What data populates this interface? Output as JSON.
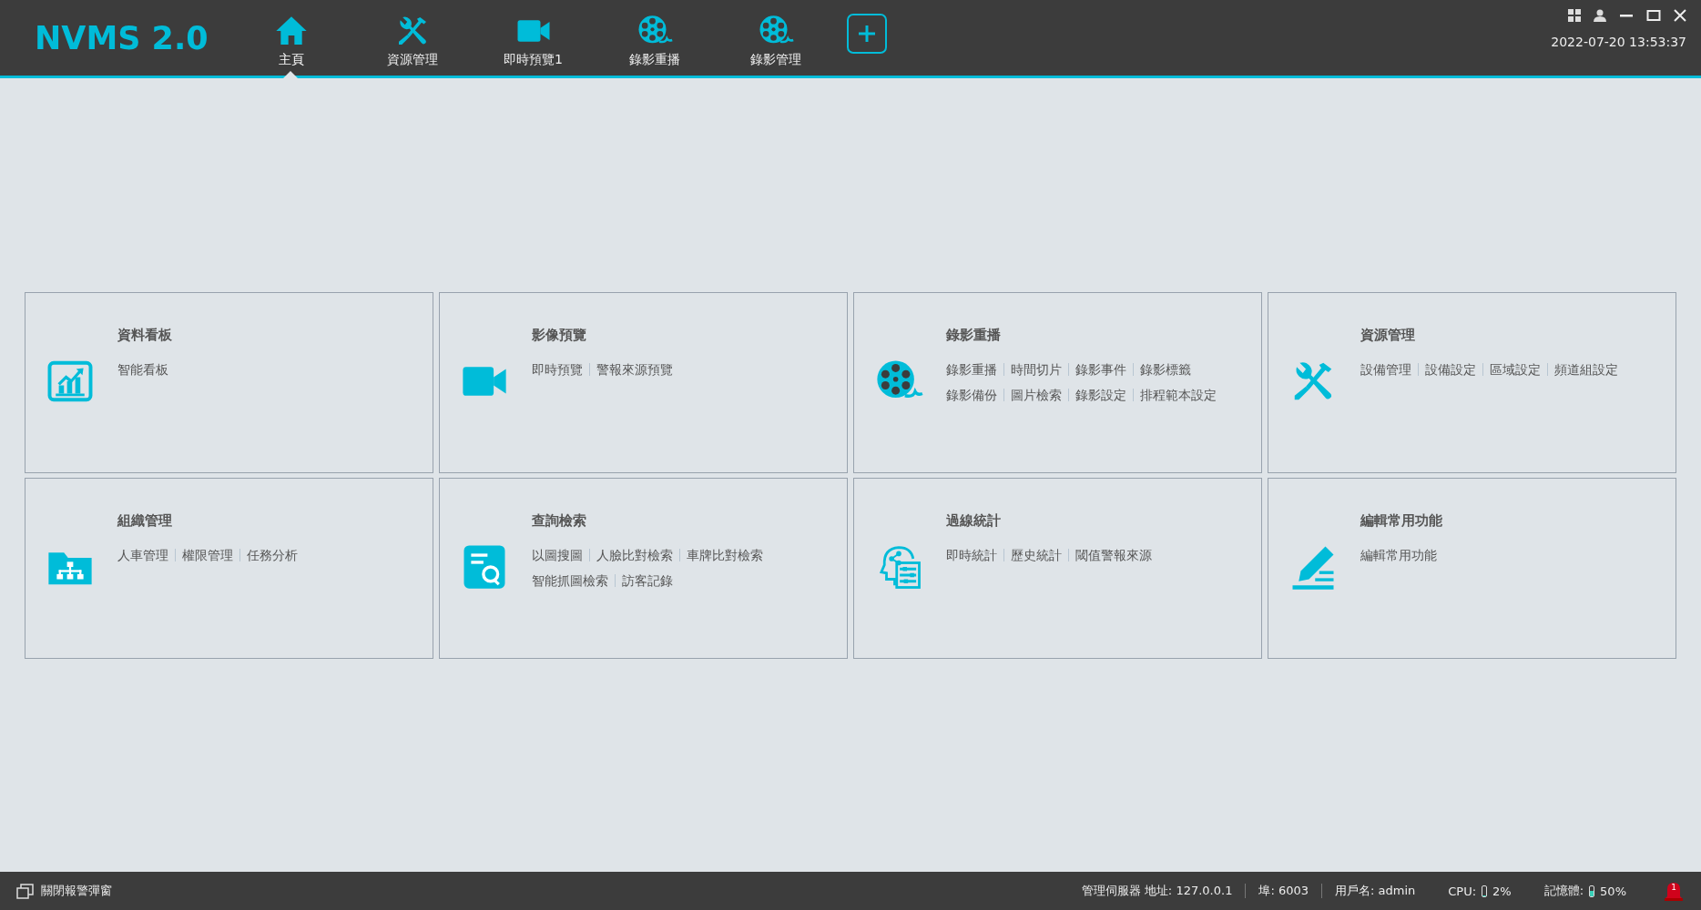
{
  "app": {
    "logo": "NVMS 2.0",
    "datetime": "2022-07-20 13:53:37"
  },
  "nav": [
    {
      "label": "主頁",
      "kind": "home",
      "selected": true
    },
    {
      "label": "資源管理",
      "kind": "tools",
      "selected": false
    },
    {
      "label": "即時預覽1",
      "kind": "camera",
      "selected": false
    },
    {
      "label": "錄影重播",
      "kind": "reel",
      "selected": false
    },
    {
      "label": "錄影管理",
      "kind": "reel",
      "selected": false
    }
  ],
  "cards": [
    {
      "title": "資料看板",
      "kind": "chart",
      "link_rows": [
        [
          "智能看板"
        ]
      ]
    },
    {
      "title": "影像預覽",
      "kind": "camera",
      "link_rows": [
        [
          "即時預覽",
          "警報來源預覽"
        ]
      ]
    },
    {
      "title": "錄影重播",
      "kind": "reel",
      "link_rows": [
        [
          "錄影重播",
          "時間切片",
          "錄影事件",
          "錄影標籤"
        ],
        [
          "錄影備份",
          "圖片檢索",
          "錄影設定",
          "排程範本設定"
        ]
      ]
    },
    {
      "title": "資源管理",
      "kind": "tools",
      "link_rows": [
        [
          "設備管理",
          "設備設定",
          "區域設定",
          "頻道組設定"
        ]
      ]
    },
    {
      "title": "組織管理",
      "kind": "folder",
      "link_rows": [
        [
          "人車管理",
          "權限管理",
          "任務分析"
        ]
      ]
    },
    {
      "title": "查詢檢索",
      "kind": "search",
      "link_rows": [
        [
          "以圖搜圖",
          "人臉比對檢索",
          "車牌比對檢索"
        ],
        [
          "智能抓圖檢索",
          "訪客記錄"
        ]
      ]
    },
    {
      "title": "過線統計",
      "kind": "analytics",
      "link_rows": [
        [
          "即時統計",
          "歷史統計",
          "閾值警報來源"
        ]
      ]
    },
    {
      "title": "編輯常用功能",
      "kind": "edit",
      "link_rows": [
        [
          "編輯常用功能"
        ]
      ]
    }
  ],
  "status_bar": {
    "close_alarm_popup": "關閉報警彈窗",
    "server": "管理伺服器 地址: 127.0.0.1",
    "port": "埠: 6003",
    "user": "用戶名: admin",
    "cpu": {
      "label": "CPU:",
      "level": 0.02,
      "reading": "2%"
    },
    "memory": {
      "label": "記憶體:",
      "level": 0.5,
      "reading": "50%"
    },
    "alarm_count": "1"
  }
}
